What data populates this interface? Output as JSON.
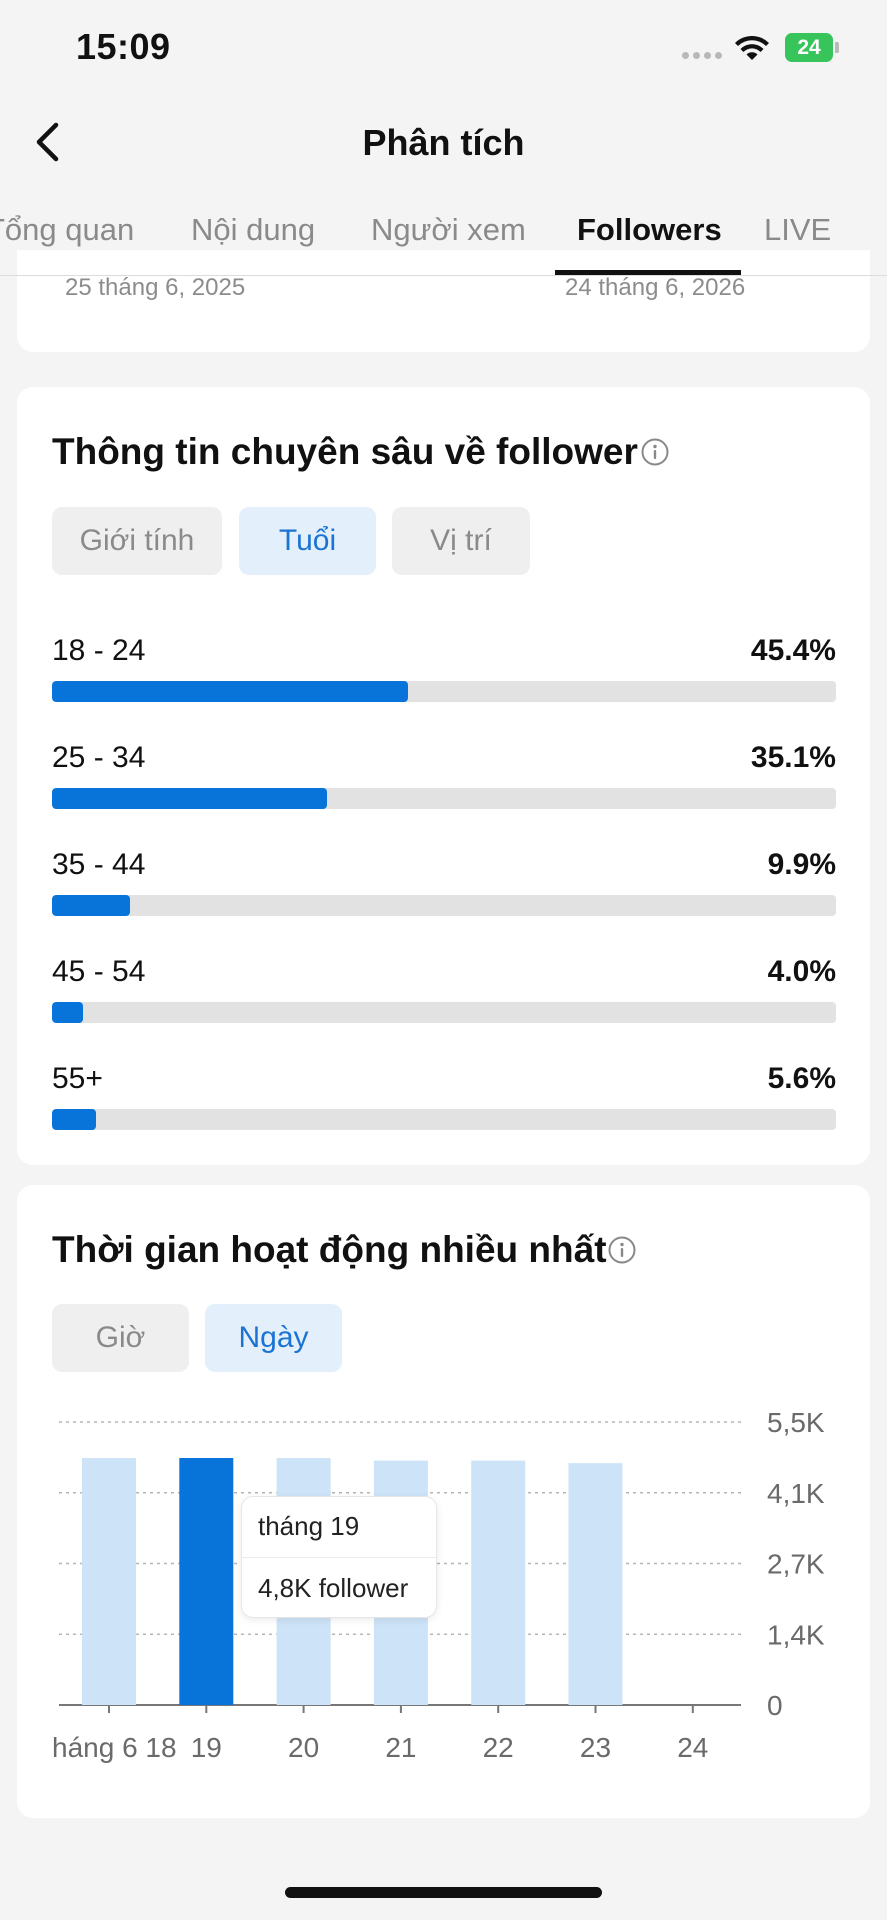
{
  "status_bar": {
    "time": "15:09",
    "battery": "24"
  },
  "header": {
    "title": "Phân tích"
  },
  "tabs": [
    {
      "label": "Tổng quan",
      "active": false
    },
    {
      "label": "Nội dung",
      "active": false
    },
    {
      "label": "Người xem",
      "active": false
    },
    {
      "label": "Followers",
      "active": true
    },
    {
      "label": "LIVE",
      "active": false
    }
  ],
  "date_range": {
    "start": "25 tháng 6, 2025",
    "end": "24 tháng 6, 2026"
  },
  "follower_insights": {
    "title": "Thông tin chuyên sâu về follower",
    "filters": [
      {
        "label": "Giới tính",
        "active": false
      },
      {
        "label": "Tuổi",
        "active": true
      },
      {
        "label": "Vị trí",
        "active": false
      }
    ],
    "age_groups": [
      {
        "label": "18 - 24",
        "percent_text": "45.4%",
        "fraction": 0.454
      },
      {
        "label": "25 - 34",
        "percent_text": "35.1%",
        "fraction": 0.351
      },
      {
        "label": "35 - 44",
        "percent_text": "9.9%",
        "fraction": 0.099
      },
      {
        "label": "45 - 54",
        "percent_text": "4.0%",
        "fraction": 0.04
      },
      {
        "label": "55+",
        "percent_text": "5.6%",
        "fraction": 0.056
      }
    ]
  },
  "active_times": {
    "title": "Thời gian hoạt động nhiều nhất",
    "filters": [
      {
        "label": "Giờ",
        "active": false
      },
      {
        "label": "Ngày",
        "active": true
      }
    ],
    "tooltip": {
      "title": "tháng 19",
      "value": "4,8K follower"
    }
  },
  "chart_data": {
    "type": "bar",
    "categories": [
      "háng 6 18",
      "19",
      "20",
      "21",
      "22",
      "23",
      "24"
    ],
    "values": [
      4.8,
      4.8,
      4.8,
      4.75,
      4.75,
      4.7,
      0
    ],
    "highlighted_index": 1,
    "y_ticks": [
      "0",
      "1,4K",
      "2,7K",
      "4,1K",
      "5,5K"
    ],
    "ylim": [
      0,
      5.5
    ],
    "grid": true,
    "colors": {
      "bar": "#cde3f7",
      "highlight": "#0874d9",
      "axis": "#777777",
      "grid": "#b5b5b5"
    }
  }
}
